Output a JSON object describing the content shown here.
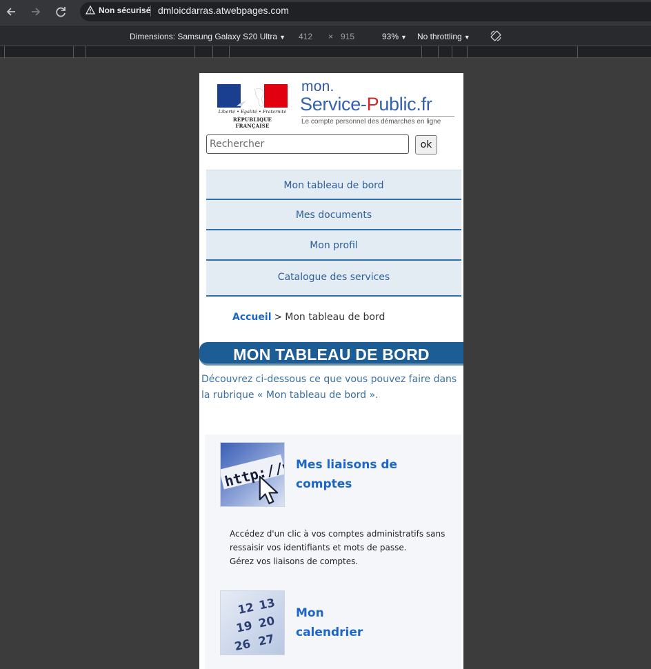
{
  "browser": {
    "back_icon": "arrow-left-icon",
    "forward_icon": "arrow-right-icon",
    "reload_icon": "reload-icon",
    "security_label": "Non sécurisé",
    "url": "dmloicdarras.atwebpages.com"
  },
  "devtools": {
    "dimensions_label": "Dimensions: Samsung Galaxy S20 Ultra",
    "width": "412",
    "times": "×",
    "height": "915",
    "zoom": "93%",
    "throttling": "No throttling",
    "rotate_icon": "rotate-icon"
  },
  "header": {
    "rf_devise": "Liberté • Égalité • Fraternité",
    "rf_name": "RÉPUBLIQUE FRANÇAISE",
    "brand_mon": "mon.",
    "brand_service": "Service-",
    "brand_p": "P",
    "brand_ublic": "ublic.fr",
    "tagline": "Le compte personnel des démarches en ligne"
  },
  "search": {
    "placeholder": "Rechercher",
    "value": "",
    "button_label": "ok"
  },
  "menu": {
    "items": [
      {
        "label": "Mon tableau de bord"
      },
      {
        "label": "Mes documents"
      },
      {
        "label": "Mon profil"
      },
      {
        "label": "Catalogue des services"
      }
    ]
  },
  "breadcrumb": {
    "home": "Accueil",
    "separator": ">",
    "current": "Mon tableau de bord"
  },
  "main": {
    "title": "MON TABLEAU DE BORD",
    "intro": "Découvrez ci-dessous ce que vous pouvez faire dans la rubrique « Mon tableau de bord ».",
    "cards": [
      {
        "title_line1": "Mes liaisons de",
        "title_line2": "comptes",
        "desc_line1": "Accédez d'un clic à vos comptes administratifs sans",
        "desc_line2": "ressaisir vos identifiants et mots de passe.",
        "desc_line3": "Gérez vos liaisons de comptes.",
        "image_text": "http://ww"
      },
      {
        "title_line1": "Mon",
        "title_line2": "calendrier",
        "image_numbers": [
          "12",
          "13",
          "19",
          "20",
          "26",
          "27"
        ]
      }
    ]
  },
  "colors": {
    "accent": "#1c66c9",
    "banner": "#1d5d95",
    "menu_bg": "#e3ebf3",
    "menu_border": "#2f6ea8",
    "brand_red": "#d5242a"
  }
}
